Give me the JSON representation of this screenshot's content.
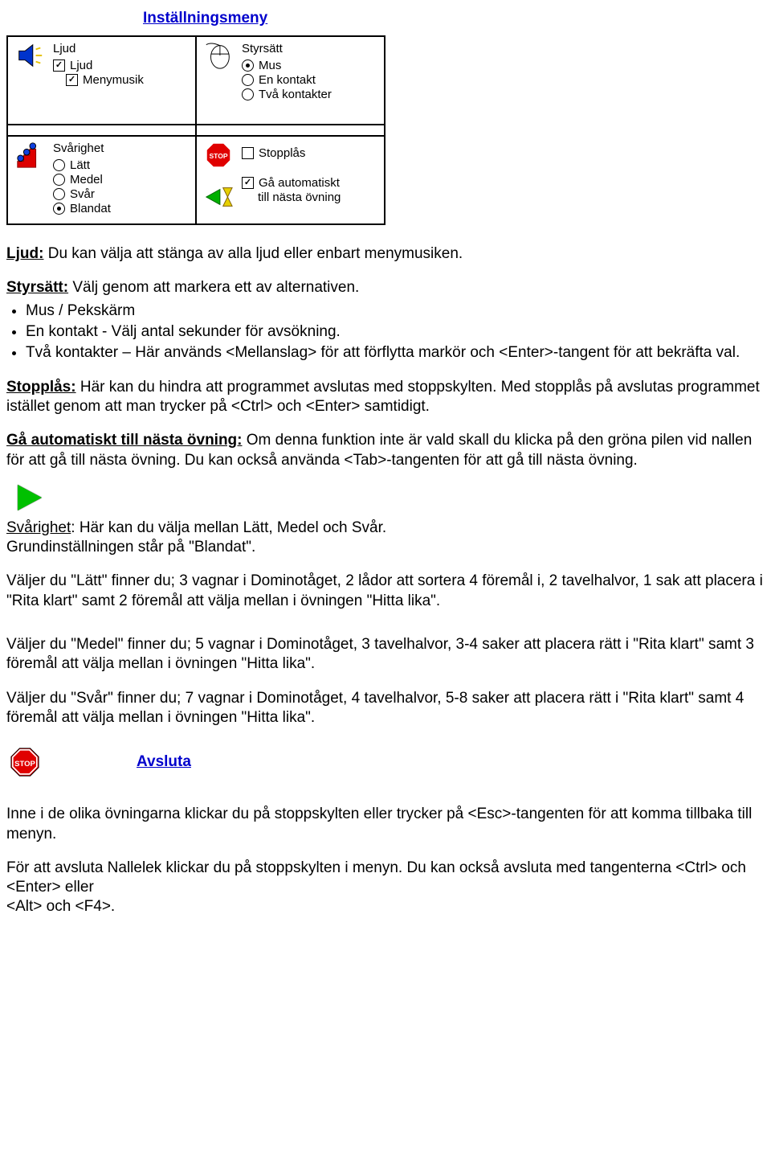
{
  "title": "Inställningsmeny",
  "panel": {
    "ljud": {
      "title": "Ljud",
      "opts": [
        "Ljud",
        "Menymusik"
      ]
    },
    "styrsatt": {
      "title": "Styrsätt",
      "opts": [
        "Mus",
        "En kontakt",
        "Två kontakter"
      ]
    },
    "svarighet": {
      "title": "Svårighet",
      "opts": [
        "Lätt",
        "Medel",
        "Svår",
        "Blandat"
      ]
    },
    "stopplas": {
      "label": "Stopplås",
      "auto1": "Gå automatiskt",
      "auto2": "till nästa övning"
    }
  },
  "body": {
    "ljud_lead": "Ljud:",
    "ljud_text": " Du kan välja att stänga av alla ljud eller enbart menymusiken.",
    "styr_lead": "Styrsätt:",
    "styr_text": " Välj genom att markera ett av alternativen.",
    "styr_b1": "Mus / Pekskärm",
    "styr_b2": "En kontakt - Välj antal sekunder för avsökning.",
    "styr_b3": "Två kontakter – Här används <Mellanslag> för att förflytta markör och <Enter>-tangent för att bekräfta val.",
    "stop_lead": "Stopplås:",
    "stop_text": " Här kan du hindra att programmet avslutas med stoppskylten. Med stopplås på avslutas programmet istället genom att man trycker på <Ctrl> och <Enter> samtidigt.",
    "auto_lead": "Gå automatiskt till nästa övning:",
    "auto_text": " Om denna funktion inte är vald skall du klicka på den gröna pilen vid nallen för att gå till nästa övning. Du kan också använda <Tab>-tangenten för att gå till nästa övning.",
    "svar_lead": "Svårighet",
    "svar_text1": ": Här kan du välja mellan Lätt, Medel och Svår.",
    "svar_text2": "Grundinställningen står på \"Blandat\".",
    "latt": "Väljer du \"Lätt\" finner du; 3 vagnar i Dominotåget, 2 lådor att sortera 4 föremål i, 2 tavelhalvor, 1 sak att placera i \"Rita klart\" samt 2 föremål att välja mellan i övningen \"Hitta lika\".",
    "medel": "Väljer du \"Medel\" finner du; 5 vagnar i Dominotåget, 3 tavelhalvor, 3-4 saker att placera rätt i \"Rita klart\" samt 3 föremål att välja mellan i övningen \"Hitta lika\".",
    "svar": "Väljer du \"Svår\" finner du; 7 vagnar i Dominotåget, 4 tavelhalvor, 5-8 saker att placera rätt i \"Rita klart\" samt 4 föremål att välja mellan i övningen \"Hitta lika\".",
    "avsluta_title": "Avsluta",
    "avsluta_p1": "Inne i de olika övningarna klickar du på stoppskylten eller trycker på <Esc>-tangenten för att komma tillbaka till menyn.",
    "avsluta_p2": "För att avsluta Nallelek klickar du på stoppskylten i menyn. Du kan också avsluta med tangenterna <Ctrl> och <Enter> eller",
    "avsluta_p3": "<Alt> och <F4>."
  }
}
